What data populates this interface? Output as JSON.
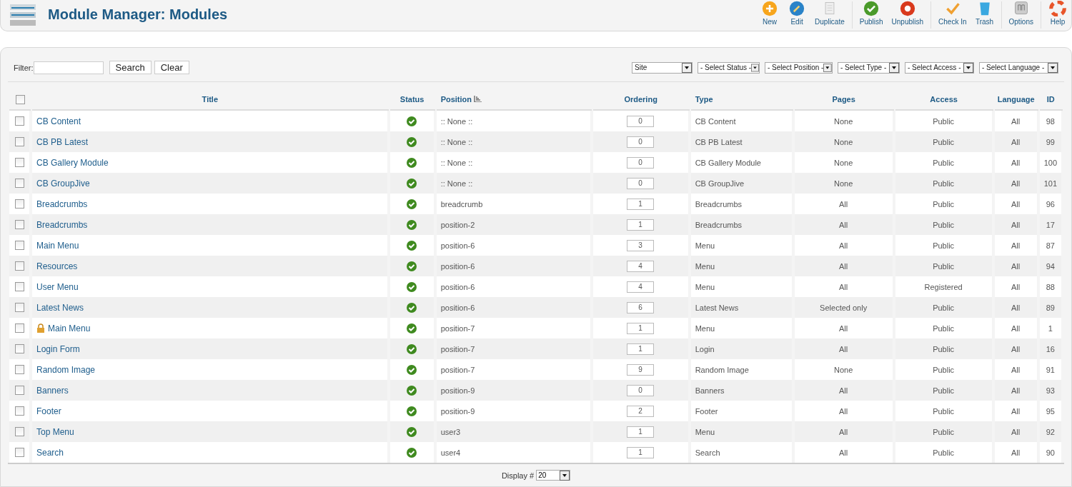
{
  "header": {
    "title": "Module Manager: Modules"
  },
  "toolbar": [
    {
      "kind": "new",
      "label": "New"
    },
    {
      "kind": "edit",
      "label": "Edit"
    },
    {
      "kind": "duplicate",
      "label": "Duplicate"
    },
    {
      "kind": "publish",
      "label": "Publish"
    },
    {
      "kind": "unpublish",
      "label": "Unpublish"
    },
    {
      "kind": "checkin",
      "label": "Check In"
    },
    {
      "kind": "trash",
      "label": "Trash"
    },
    {
      "kind": "options",
      "label": "Options"
    },
    {
      "kind": "help",
      "label": "Help"
    }
  ],
  "filter": {
    "label": "Filter:",
    "search_button": "Search",
    "clear_button": "Clear"
  },
  "selects": [
    "Site",
    "- Select Status -",
    "- Select Position -",
    "- Select Type -",
    "- Select Access -",
    "- Select Language -"
  ],
  "table": {
    "select_all_checked": false,
    "columns": [
      "Title",
      "Status",
      "Position",
      "Ordering",
      "Type",
      "Pages",
      "Access",
      "Language",
      "ID"
    ],
    "rows": [
      {
        "checked": false,
        "locked": false,
        "title": "CB Content",
        "published": true,
        "position": ":: None ::",
        "ordering": "0",
        "type": "CB Content",
        "pages": "None",
        "access": "Public",
        "language": "All",
        "id": "98"
      },
      {
        "checked": false,
        "locked": false,
        "title": "CB PB Latest",
        "published": true,
        "position": ":: None ::",
        "ordering": "0",
        "type": "CB PB Latest",
        "pages": "None",
        "access": "Public",
        "language": "All",
        "id": "99"
      },
      {
        "checked": false,
        "locked": false,
        "title": "CB Gallery Module",
        "published": true,
        "position": ":: None ::",
        "ordering": "0",
        "type": "CB Gallery Module",
        "pages": "None",
        "access": "Public",
        "language": "All",
        "id": "100"
      },
      {
        "checked": false,
        "locked": false,
        "title": "CB GroupJive",
        "published": true,
        "position": ":: None ::",
        "ordering": "0",
        "type": "CB GroupJive",
        "pages": "None",
        "access": "Public",
        "language": "All",
        "id": "101"
      },
      {
        "checked": false,
        "locked": false,
        "title": "Breadcrumbs",
        "published": true,
        "position": "breadcrumb",
        "ordering": "1",
        "type": "Breadcrumbs",
        "pages": "All",
        "access": "Public",
        "language": "All",
        "id": "96"
      },
      {
        "checked": false,
        "locked": false,
        "title": "Breadcrumbs",
        "published": true,
        "position": "position-2",
        "ordering": "1",
        "type": "Breadcrumbs",
        "pages": "All",
        "access": "Public",
        "language": "All",
        "id": "17"
      },
      {
        "checked": false,
        "locked": false,
        "title": "Main Menu",
        "published": true,
        "position": "position-6",
        "ordering": "3",
        "type": "Menu",
        "pages": "All",
        "access": "Public",
        "language": "All",
        "id": "87"
      },
      {
        "checked": false,
        "locked": false,
        "title": "Resources",
        "published": true,
        "position": "position-6",
        "ordering": "4",
        "type": "Menu",
        "pages": "All",
        "access": "Public",
        "language": "All",
        "id": "94"
      },
      {
        "checked": false,
        "locked": false,
        "title": "User Menu",
        "published": true,
        "position": "position-6",
        "ordering": "4",
        "type": "Menu",
        "pages": "All",
        "access": "Registered",
        "language": "All",
        "id": "88"
      },
      {
        "checked": false,
        "locked": false,
        "title": "Latest News",
        "published": true,
        "position": "position-6",
        "ordering": "6",
        "type": "Latest News",
        "pages": "Selected only",
        "access": "Public",
        "language": "All",
        "id": "89"
      },
      {
        "checked": false,
        "locked": true,
        "title": "Main Menu",
        "published": true,
        "position": "position-7",
        "ordering": "1",
        "type": "Menu",
        "pages": "All",
        "access": "Public",
        "language": "All",
        "id": "1"
      },
      {
        "checked": false,
        "locked": false,
        "title": "Login Form",
        "published": true,
        "position": "position-7",
        "ordering": "1",
        "type": "Login",
        "pages": "All",
        "access": "Public",
        "language": "All",
        "id": "16"
      },
      {
        "checked": false,
        "locked": false,
        "title": "Random Image",
        "published": true,
        "position": "position-7",
        "ordering": "9",
        "type": "Random Image",
        "pages": "None",
        "access": "Public",
        "language": "All",
        "id": "91"
      },
      {
        "checked": false,
        "locked": false,
        "title": "Banners",
        "published": true,
        "position": "position-9",
        "ordering": "0",
        "type": "Banners",
        "pages": "All",
        "access": "Public",
        "language": "All",
        "id": "93"
      },
      {
        "checked": false,
        "locked": false,
        "title": "Footer",
        "published": true,
        "position": "position-9",
        "ordering": "2",
        "type": "Footer",
        "pages": "All",
        "access": "Public",
        "language": "All",
        "id": "95"
      },
      {
        "checked": false,
        "locked": false,
        "title": "Top Menu",
        "published": true,
        "position": "user3",
        "ordering": "1",
        "type": "Menu",
        "pages": "All",
        "access": "Public",
        "language": "All",
        "id": "92"
      },
      {
        "checked": false,
        "locked": false,
        "title": "Search",
        "published": true,
        "position": "user4",
        "ordering": "1",
        "type": "Search",
        "pages": "All",
        "access": "Public",
        "language": "All",
        "id": "90"
      }
    ]
  },
  "footer": {
    "label": "Display #",
    "value": "20"
  }
}
